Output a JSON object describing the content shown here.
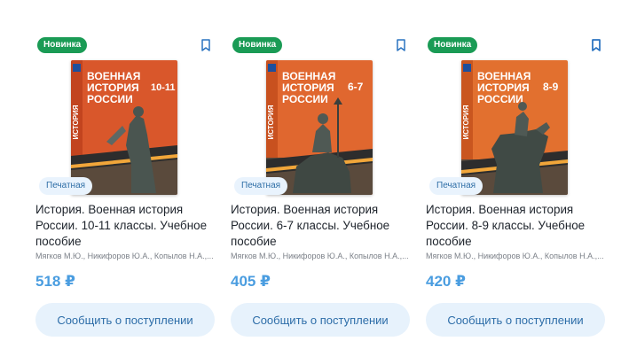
{
  "products": [
    {
      "badge_new": "Новинка",
      "badge_format": "Печатная",
      "title": "История. Военная история России. 10-11 классы. Учебное пособие",
      "authors": "Мягков М.Ю., Никифоров Ю.А., Копылов Н.А.,...",
      "price": "518 ₽",
      "button_label": "Сообщить о поступлении",
      "cover": {
        "spine": "ИСТОРИЯ",
        "line1": "ВОЕННАЯ",
        "line2": "ИСТОРИЯ",
        "line3": "РОССИИ",
        "grade": "10-11",
        "bg": "#d9572b"
      }
    },
    {
      "badge_new": "Новинка",
      "badge_format": "Печатная",
      "title": "История. Военная история России. 6-7 классы. Учебное пособие",
      "authors": "Мягков М.Ю., Никифоров Ю.А., Копылов Н.А.,...",
      "price": "405 ₽",
      "button_label": "Сообщить о поступлении",
      "cover": {
        "spine": "ИСТОРИЯ",
        "line1": "ВОЕННАЯ",
        "line2": "ИСТОРИЯ",
        "line3": "РОССИИ",
        "grade": "6-7",
        "bg": "#e0672f"
      }
    },
    {
      "badge_new": "Новинка",
      "badge_format": "Печатная",
      "title": "История. Военная история России. 8-9 классы. Учебное пособие",
      "authors": "Мягков М.Ю., Никифоров Ю.А., Копылов Н.А.,...",
      "price": "420 ₽",
      "button_label": "Сообщить о поступлении",
      "cover": {
        "spine": "ИСТОРИЯ",
        "line1": "ВОЕННАЯ",
        "line2": "ИСТОРИЯ",
        "line3": "РОССИИ",
        "grade": "8-9",
        "bg": "#e2702f"
      }
    }
  ],
  "icons": {
    "bookmark": "bookmark-icon"
  },
  "colors": {
    "badge_new_bg": "#1a9b55",
    "price": "#4a9de0",
    "button_bg": "#e7f2fc",
    "button_text": "#2d6da8"
  }
}
